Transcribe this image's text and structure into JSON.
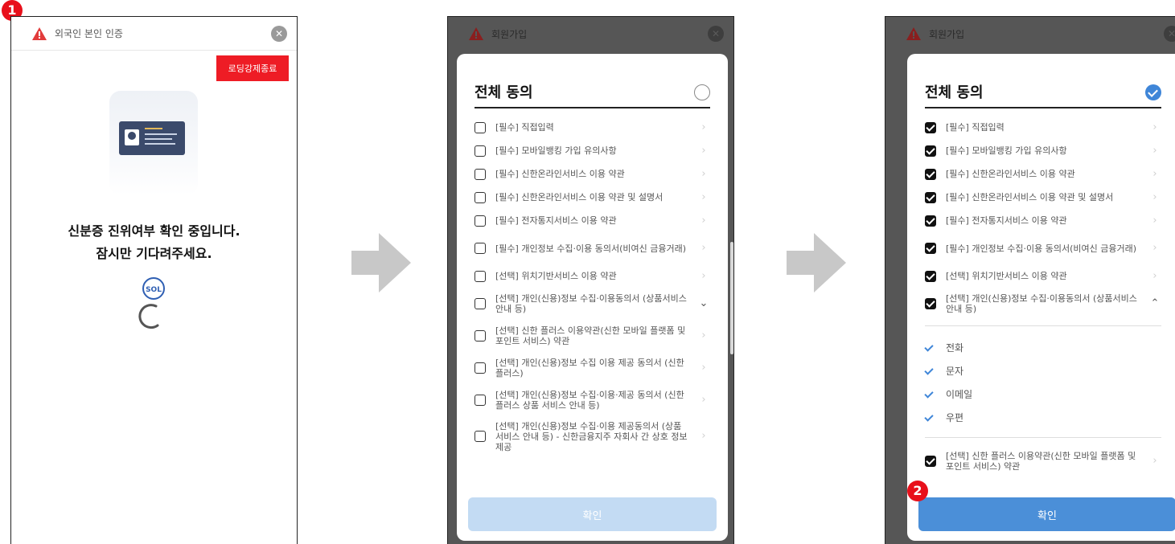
{
  "screen1": {
    "title": "외국인 본인 인증",
    "force_quit_label": "로딩강제종료",
    "message_line1": "신분증 진위여부 확인 중입니다.",
    "message_line2": "잠시만 기다려주세요.",
    "sol_logo_text": "SOL"
  },
  "screen2": {
    "title": "회원가입",
    "agree_all": "전체 동의",
    "items": [
      "[필수] 직접입력",
      "[필수] 모바일뱅킹 가입 유의사항",
      "[필수] 신한온라인서비스 이용 약관",
      "[필수] 신한온라인서비스 이용 약관 및 설명서",
      "[필수] 전자통지서비스 이용 약관",
      "[필수] 개인정보 수집·이용 동의서(비여신 금융거래)",
      "[선택] 위치기반서비스 이용 약관",
      "[선택] 개인(신용)정보 수집·이용동의서 (상품서비스 안내 등)",
      "[선택] 신한 플러스 이용약관(신한 모바일 플랫폼 및 포인트 서비스) 약관",
      "[선택] 개인(신용)정보 수집 이용 제공 동의서 (신한플러스)",
      "[선택] 개인(신용)정보 수집·이용·제공 동의서 (신한플러스 상품 서비스 안내 등)",
      "[선택] 개인(신용)정보 수집·이용 제공동의서 (상품서비스 안내 등) - 신한금융지주 자회사 간 상호 정보제공"
    ],
    "confirm_label": "확인"
  },
  "screen3": {
    "title": "회원가입",
    "agree_all": "전체 동의",
    "items": [
      "[필수] 직접입력",
      "[필수] 모바일뱅킹 가입 유의사항",
      "[필수] 신한온라인서비스 이용 약관",
      "[필수] 신한온라인서비스 이용 약관 및 설명서",
      "[필수] 전자통지서비스 이용 약관",
      "[필수] 개인정보 수집·이용 동의서(비여신 금융거래)",
      "[선택] 위치기반서비스 이용 약관",
      "[선택] 개인(신용)정보 수집·이용동의서 (상품서비스 안내 등)"
    ],
    "channels": [
      "전화",
      "문자",
      "이메일",
      "우편"
    ],
    "extra_item": "[선택] 신한 플러스 이용약관(신한 모바일 플랫폼 및 포인트 서비스) 약관",
    "confirm_label": "확인"
  },
  "badges": [
    "1",
    "2"
  ],
  "colors": {
    "accent_red": "#ee1c25",
    "badge_red": "#e8101b",
    "confirm_blue": "#4b8fd8",
    "confirm_disabled": "#c3dbf3",
    "check_blue": "#3f86d8",
    "arrow_gray": "#c8c8c8"
  },
  "icons": [
    "warning-icon",
    "close-icon",
    "chevron-right-icon",
    "chevron-down-icon",
    "chevron-up-icon",
    "checkbox-icon",
    "check-icon",
    "arrow-right-icon",
    "loading-spinner-icon",
    "sol-logo-icon",
    "id-card-icon"
  ]
}
